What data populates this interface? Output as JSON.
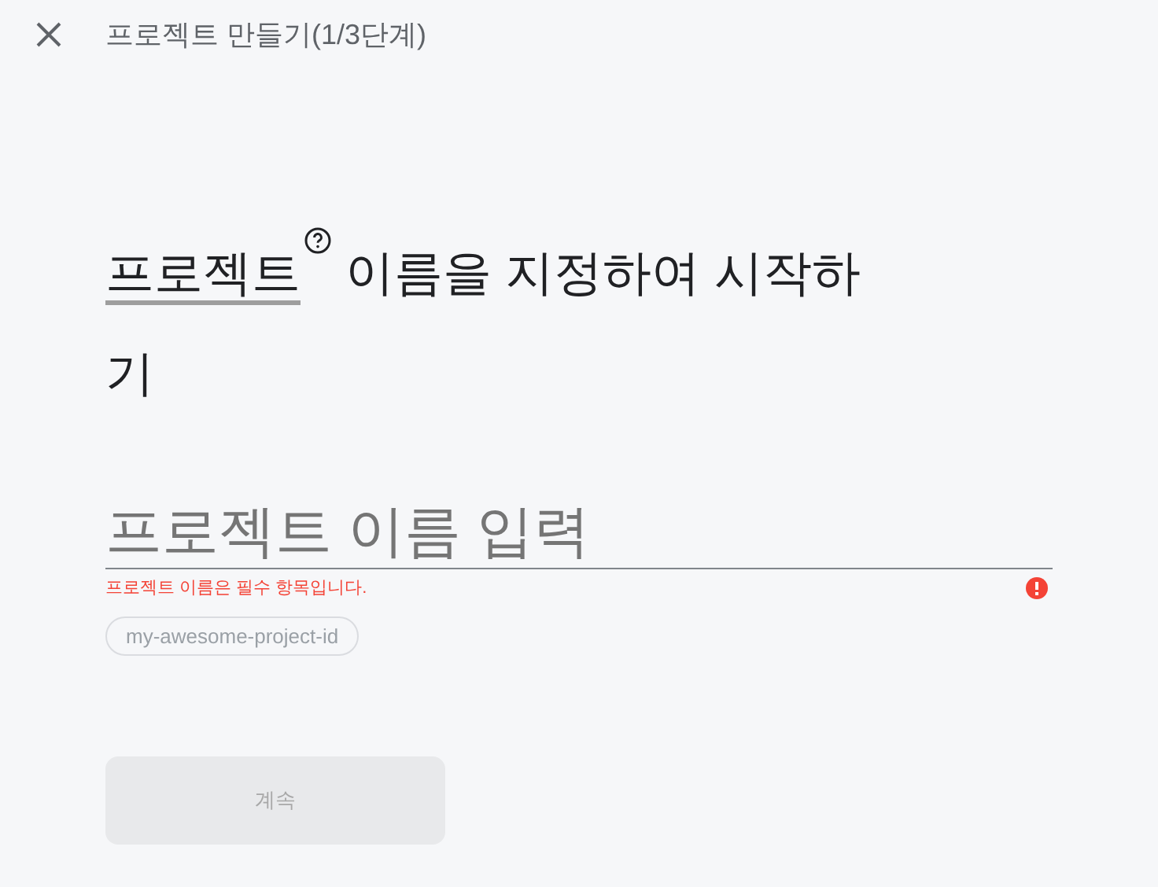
{
  "header": {
    "title": "프로젝트 만들기(1/3단계)"
  },
  "heading": {
    "term": "프로젝트",
    "rest": " 이름을 지정하여 시작하기"
  },
  "name_field": {
    "placeholder": "프로젝트 이름 입력",
    "error": true,
    "error_text": "프로젝트 이름은 필수 항목입니다."
  },
  "project_id": "my-awesome-project-id",
  "continue_button": {
    "label": "계속",
    "disabled": true
  }
}
